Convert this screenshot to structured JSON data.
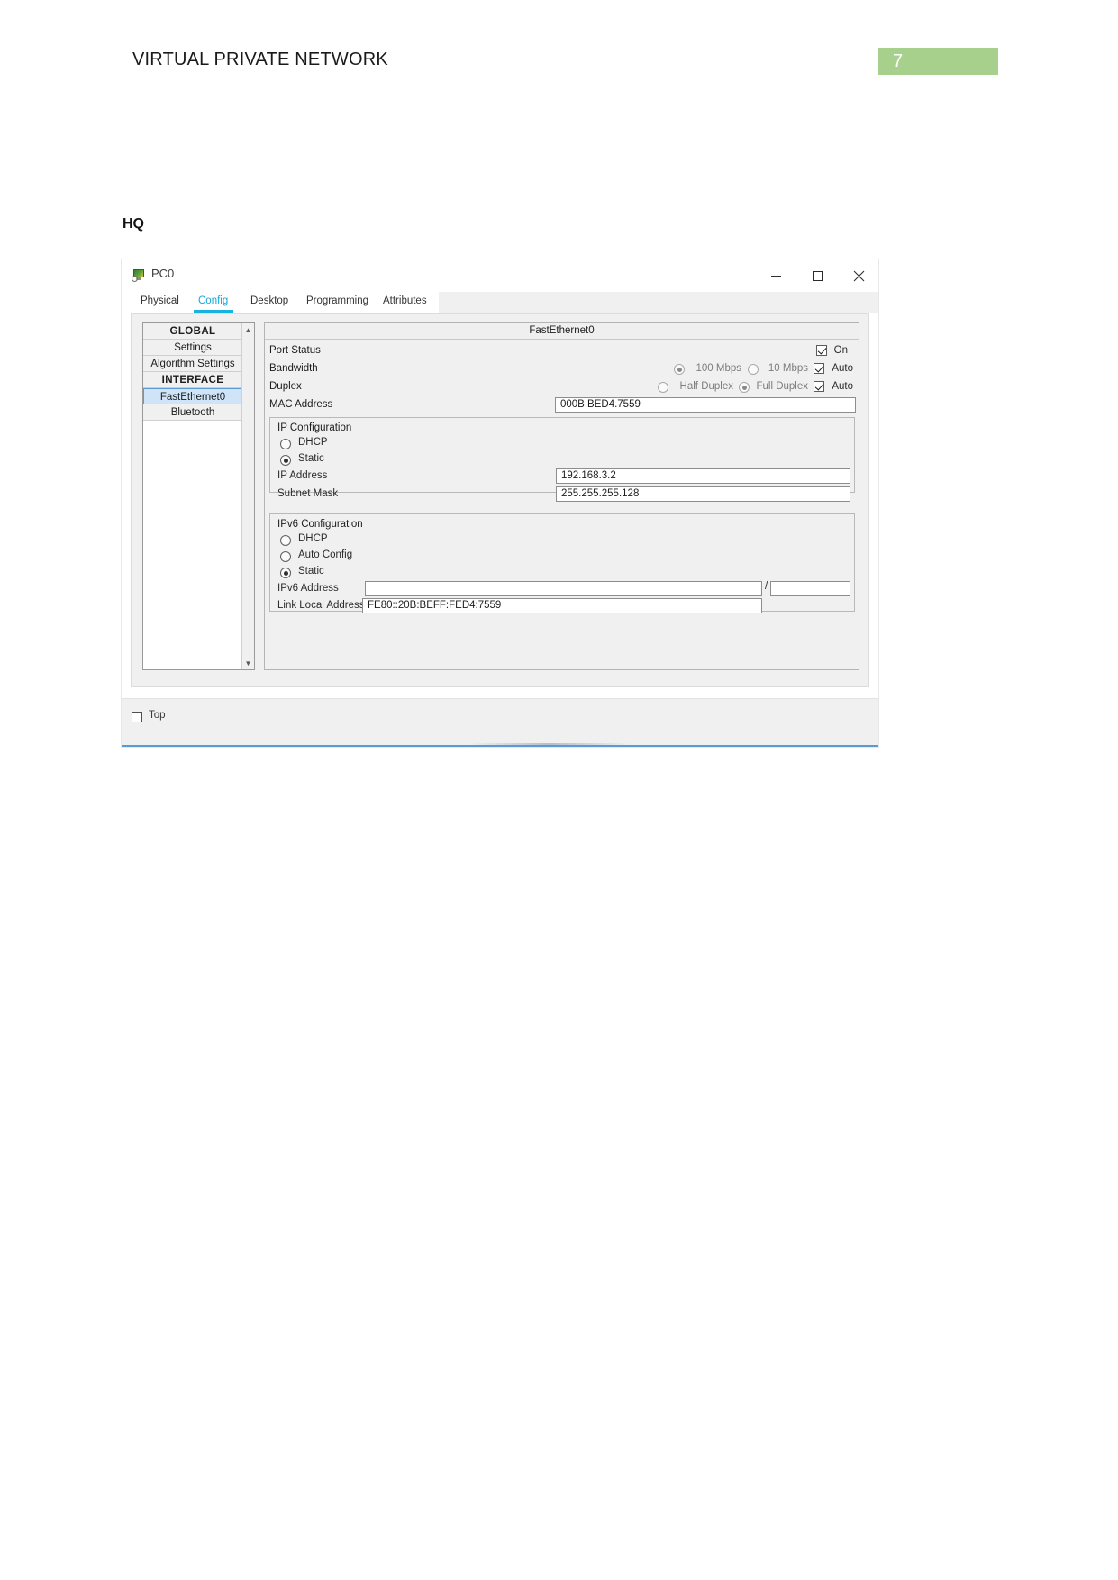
{
  "document": {
    "running_head": "VIRTUAL PRIVATE NETWORK",
    "page_number": "7",
    "accent_color": "#a8d08d",
    "section_label": "HQ"
  },
  "window": {
    "title": "PC0",
    "icon": "pc-device-icon",
    "controls": {
      "minimize": "–",
      "maximize": "□",
      "close": "×"
    },
    "tabs": [
      {
        "label": "Physical",
        "active": false
      },
      {
        "label": "Config",
        "active": true
      },
      {
        "label": "Desktop",
        "active": false
      },
      {
        "label": "Programming",
        "active": false
      },
      {
        "label": "Attributes",
        "active": false
      }
    ]
  },
  "sidebar": {
    "items": [
      {
        "label": "GLOBAL",
        "type": "header"
      },
      {
        "label": "Settings",
        "type": "item"
      },
      {
        "label": "Algorithm Settings",
        "type": "item"
      },
      {
        "label": "INTERFACE",
        "type": "header"
      },
      {
        "label": "FastEthernet0",
        "type": "item",
        "selected": true
      },
      {
        "label": "Bluetooth",
        "type": "item"
      }
    ]
  },
  "config_panel": {
    "title": "FastEthernet0",
    "port_status": {
      "label": "Port Status",
      "checkbox_label": "On",
      "checked": true
    },
    "bandwidth": {
      "label": "Bandwidth",
      "options": [
        {
          "label": "100 Mbps",
          "selected": true
        },
        {
          "label": "10 Mbps",
          "selected": false
        }
      ],
      "auto_label": "Auto",
      "auto_checked": true
    },
    "duplex": {
      "label": "Duplex",
      "options": [
        {
          "label": "Half Duplex",
          "selected": false
        },
        {
          "label": "Full Duplex",
          "selected": true
        }
      ],
      "auto_label": "Auto",
      "auto_checked": true
    },
    "mac_address": {
      "label": "MAC Address",
      "value": "000B.BED4.7559"
    },
    "ip_configuration": {
      "title": "IP Configuration",
      "mode_options": [
        {
          "label": "DHCP",
          "selected": false
        },
        {
          "label": "Static",
          "selected": true
        }
      ],
      "ip_address": {
        "label": "IP Address",
        "value": "192.168.3.2"
      },
      "subnet_mask": {
        "label": "Subnet Mask",
        "value": "255.255.255.128"
      }
    },
    "ipv6_configuration": {
      "title": "IPv6 Configuration",
      "mode_options": [
        {
          "label": "DHCP",
          "selected": false
        },
        {
          "label": "Auto Config",
          "selected": false
        },
        {
          "label": "Static",
          "selected": true
        }
      ],
      "ipv6_address": {
        "label": "IPv6 Address",
        "value": "",
        "separator": "/",
        "prefix_value": ""
      },
      "link_local_address": {
        "label": "Link Local Address:",
        "value": "FE80::20B:BEFF:FED4:7559"
      }
    }
  },
  "footer": {
    "top_checkbox_label": "Top",
    "top_checked": false
  }
}
